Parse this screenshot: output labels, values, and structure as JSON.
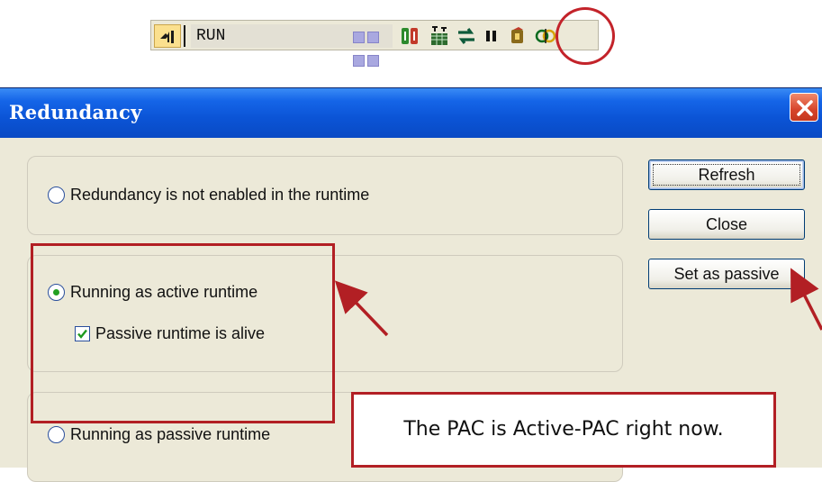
{
  "toolbar": {
    "mode_icon": "online-mode-icon",
    "status_text": "RUN",
    "led_count": 4,
    "icons": [
      "run-icon",
      "cycle-settings-icon",
      "refresh-icon",
      "pause-icon",
      "stop-icon",
      "redundancy-icon"
    ]
  },
  "dialog": {
    "title": "Redundancy",
    "close_icon": "close-icon",
    "options": [
      {
        "label": "Redundancy is not enabled in the runtime",
        "selected": false
      },
      {
        "label": "Running as active runtime",
        "selected": true
      },
      {
        "label": "Running as passive runtime",
        "selected": false
      }
    ],
    "checkbox": {
      "label": "Passive runtime is alive",
      "checked": true
    },
    "buttons": {
      "refresh": "Refresh",
      "close": "Close",
      "set_passive": "Set as passive"
    }
  },
  "annotation": {
    "callout_text": "The PAC is Active-PAC right now.",
    "color": "#b21f24"
  },
  "colors": {
    "titlebar": "#0b54d6",
    "dialog_bg": "#ece9d8",
    "close_button": "#d6442a"
  }
}
